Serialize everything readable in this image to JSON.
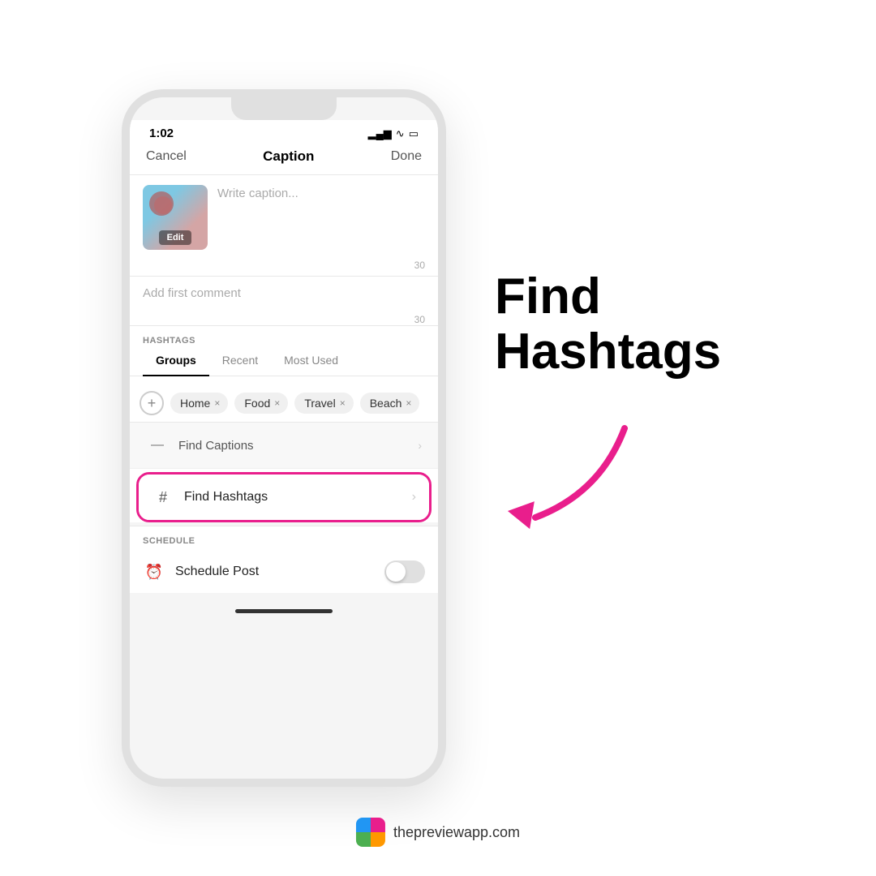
{
  "page": {
    "background": "#ffffff"
  },
  "status_bar": {
    "time": "1:02",
    "signal": "▂▄▆",
    "wifi": "wifi",
    "battery": "battery"
  },
  "nav": {
    "cancel_label": "Cancel",
    "title": "Caption",
    "done_label": "Done"
  },
  "caption": {
    "placeholder": "Write caption...",
    "char_count": "30",
    "edit_label": "Edit"
  },
  "first_comment": {
    "placeholder": "Add first comment",
    "char_count": "30"
  },
  "hashtags": {
    "section_label": "HASHTAGS",
    "tabs": [
      {
        "label": "Groups",
        "active": true
      },
      {
        "label": "Recent",
        "active": false
      },
      {
        "label": "Most Used",
        "active": false
      }
    ],
    "groups": [
      {
        "label": "Home"
      },
      {
        "label": "Food"
      },
      {
        "label": "Travel"
      },
      {
        "label": "Beach"
      }
    ]
  },
  "menu": {
    "find_captions": {
      "icon": "—",
      "label": "Find Captions",
      "dots": "⋯"
    },
    "find_hashtags": {
      "icon": "#",
      "label": "Find Hashtags",
      "chevron": "›"
    }
  },
  "schedule": {
    "section_label": "SCHEDULE",
    "schedule_post_label": "Schedule Post"
  },
  "right_content": {
    "heading_line1": "Find",
    "heading_line2": "Hashtags"
  },
  "watermark": {
    "url": "thepreviewapp.com"
  }
}
